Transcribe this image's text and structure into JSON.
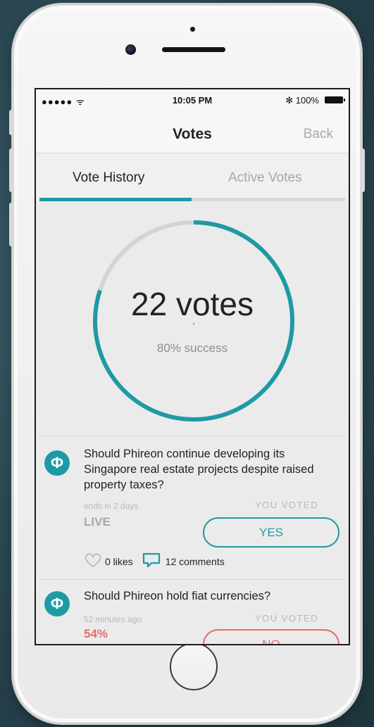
{
  "status_bar": {
    "signal": "●●●●● ᯤ",
    "time": "10:05 PM",
    "battery": "✻ 100%"
  },
  "nav": {
    "title": "Votes",
    "back_label": "Back"
  },
  "tabs": [
    {
      "label": "Vote History",
      "active": true
    },
    {
      "label": "Active Votes",
      "active": false
    }
  ],
  "summary": {
    "votes_label": "22 votes",
    "success_label": "80% success",
    "success_fraction": 0.8
  },
  "colors": {
    "accent": "#1e9aa5",
    "no_red": "#e86a6a",
    "muted": "#a8a8a8"
  },
  "votes": [
    {
      "icon": "phi-icon",
      "icon_glyph": "Φ",
      "question": "Should Phireon continue developing its Singapore real estate projects despite raised property taxes?",
      "meta": "ends in 2 days",
      "status": "LIVE",
      "voted_label": "YOU VOTED",
      "vote": "YES",
      "likes": "0 likes",
      "comments": "12 comments"
    },
    {
      "icon": "phi-icon",
      "icon_glyph": "Φ",
      "question": "Should Phireon hold fiat currencies?",
      "meta": "52 minutes ago",
      "status": "54%",
      "voted_label": "YOU VOTED",
      "vote": "NO"
    }
  ]
}
